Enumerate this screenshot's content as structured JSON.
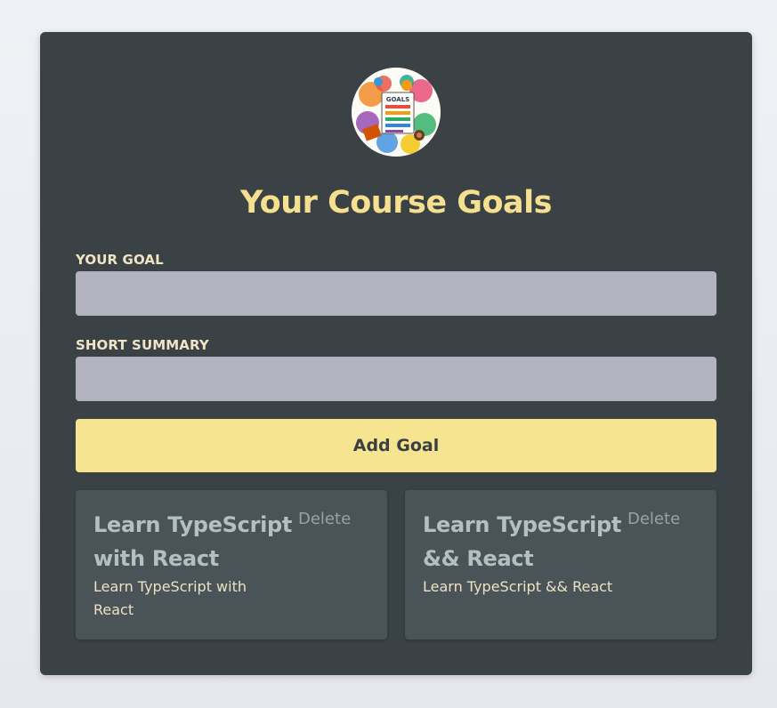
{
  "header": {
    "logo_text": "GOALS",
    "title": "Your Course Goals"
  },
  "form": {
    "goal_label": "YOUR GOAL",
    "goal_value": "",
    "summary_label": "SHORT SUMMARY",
    "summary_value": "",
    "submit_label": "Add Goal"
  },
  "goals": [
    {
      "title": "Learn TypeScript with React",
      "description": "Learn TypeScript with React",
      "delete_label": "Delete"
    },
    {
      "title": "Learn TypeScript && React",
      "description": "Learn TypeScript && React",
      "delete_label": "Delete"
    }
  ],
  "colors": {
    "card_bg": "#3a4245",
    "accent": "#f6e08f",
    "input_bg": "#b2b3bf",
    "goal_card_bg": "#4a5357",
    "goal_title": "#b3c0c2",
    "delete_text": "#99a1a2"
  }
}
